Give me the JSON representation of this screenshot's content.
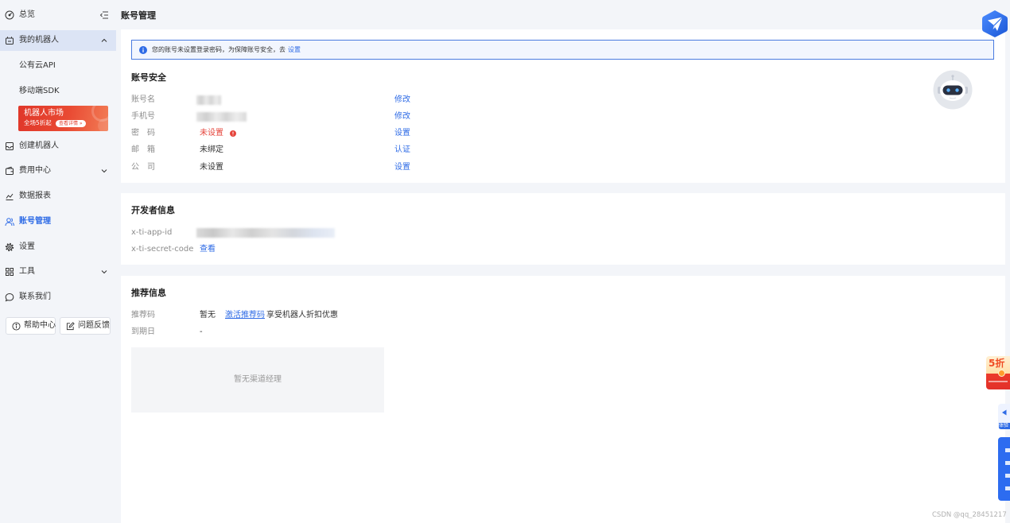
{
  "colors": {
    "accent": "#2e6be6",
    "danger": "#e5443b",
    "sidebar_active_bg": "#dce4f5",
    "page_bg": "#f3f5f9"
  },
  "sidebar": {
    "collapse_icon": "menu-fold-icon",
    "items": [
      {
        "label": "总览",
        "icon": "dashboard-icon"
      },
      {
        "label": "我的机器人",
        "icon": "robot-icon",
        "expanded": true
      },
      {
        "label": "公有云API"
      },
      {
        "label": "移动端SDK"
      },
      {
        "label": "创建机器人",
        "icon": "inbox-icon"
      },
      {
        "label": "费用中心",
        "icon": "wallet-icon",
        "expanded": false
      },
      {
        "label": "数据报表",
        "icon": "chart-icon"
      },
      {
        "label": "账号管理",
        "icon": "user-icon",
        "active": true
      },
      {
        "label": "设置",
        "icon": "gear-icon"
      },
      {
        "label": "工具",
        "icon": "grid-icon",
        "expanded": false
      },
      {
        "label": "联系我们",
        "icon": "chat-icon"
      }
    ],
    "banner": {
      "title": "机器人市场",
      "subtitle": "全场5折起",
      "cta": "查看详情 »"
    },
    "footer_buttons": [
      {
        "label": "帮助中心",
        "icon": "info-circle-icon"
      },
      {
        "label": "问题反馈",
        "icon": "edit-icon"
      }
    ]
  },
  "page_title": "账号管理",
  "alert": {
    "icon": "info-icon",
    "text": "您的账号未设置登录密码，为保障账号安全，去",
    "link": "设置"
  },
  "account_security": {
    "title": "账号安全",
    "avatar_icon": "robot-avatar-icon",
    "rows": [
      {
        "label": "账号名",
        "action": "修改"
      },
      {
        "label": "手机号",
        "action": "修改"
      },
      {
        "label": "密　码",
        "value": "未设置",
        "action": "设置"
      },
      {
        "label": "邮　箱",
        "value": "未绑定",
        "action": "认证"
      },
      {
        "label": "公　司",
        "value": "未设置",
        "action": "设置"
      }
    ]
  },
  "developer_info": {
    "title": "开发者信息",
    "rows": [
      {
        "label": "x-ti-app-id"
      },
      {
        "label": "x-ti-secret-code",
        "action": "查看"
      }
    ]
  },
  "referral_info": {
    "title": "推荐信息",
    "rows": [
      {
        "label": "推荐码",
        "value": "暂无",
        "link": "激活推荐码",
        "note": "享受机器人折扣优惠"
      },
      {
        "label": "到期日",
        "value": "-"
      }
    ],
    "channel_manager_empty": "暂无渠道经理"
  },
  "floating": {
    "logo_icon": "bird-logo-icon",
    "discount_badge": "5折",
    "trial_tab": "体验"
  },
  "watermark": "CSDN @qq_28451217"
}
